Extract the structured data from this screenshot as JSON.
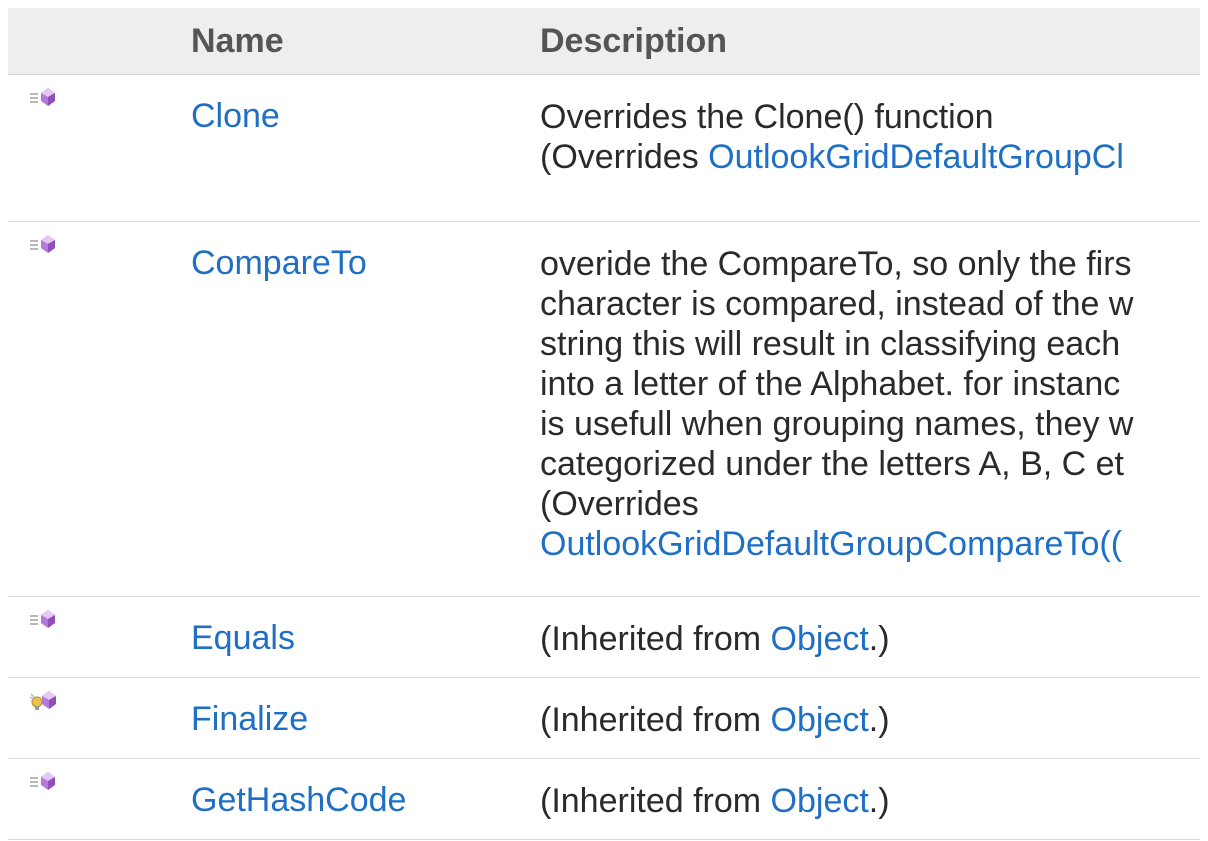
{
  "header": {
    "name_label": "Name",
    "description_label": "Description"
  },
  "rows": [
    {
      "icon": "public-method-icon",
      "name": "Clone",
      "desc_line1": "Overrides the Clone() function",
      "desc_line2_prefix": "(Overrides ",
      "desc_line2_link": "OutlookGridDefaultGroupCl"
    },
    {
      "icon": "public-method-icon",
      "name": "CompareTo",
      "desc_lines": [
        "overide the CompareTo, so only the firs",
        "character is compared, instead of the w",
        "string this will result in classifying each",
        "into a letter of the Alphabet. for instanc",
        "is usefull when grouping names, they w",
        "categorized under the letters A, B, C et",
        "(Overrides"
      ],
      "desc_link": "OutlookGridDefaultGroupCompareTo(("
    },
    {
      "icon": "public-method-icon",
      "name": "Equals",
      "desc_prefix": "(Inherited from ",
      "desc_link": "Object",
      "desc_suffix": ".)"
    },
    {
      "icon": "protected-method-icon",
      "name": "Finalize",
      "desc_prefix": "(Inherited from ",
      "desc_link": "Object",
      "desc_suffix": ".)"
    },
    {
      "icon": "public-method-icon",
      "name": "GetHashCode",
      "desc_prefix": "(Inherited from ",
      "desc_link": "Object",
      "desc_suffix": ".)"
    }
  ],
  "colors": {
    "link": "#1f6fc5",
    "header_bg": "#eeeeee",
    "method_gem": "#b57ad8"
  }
}
